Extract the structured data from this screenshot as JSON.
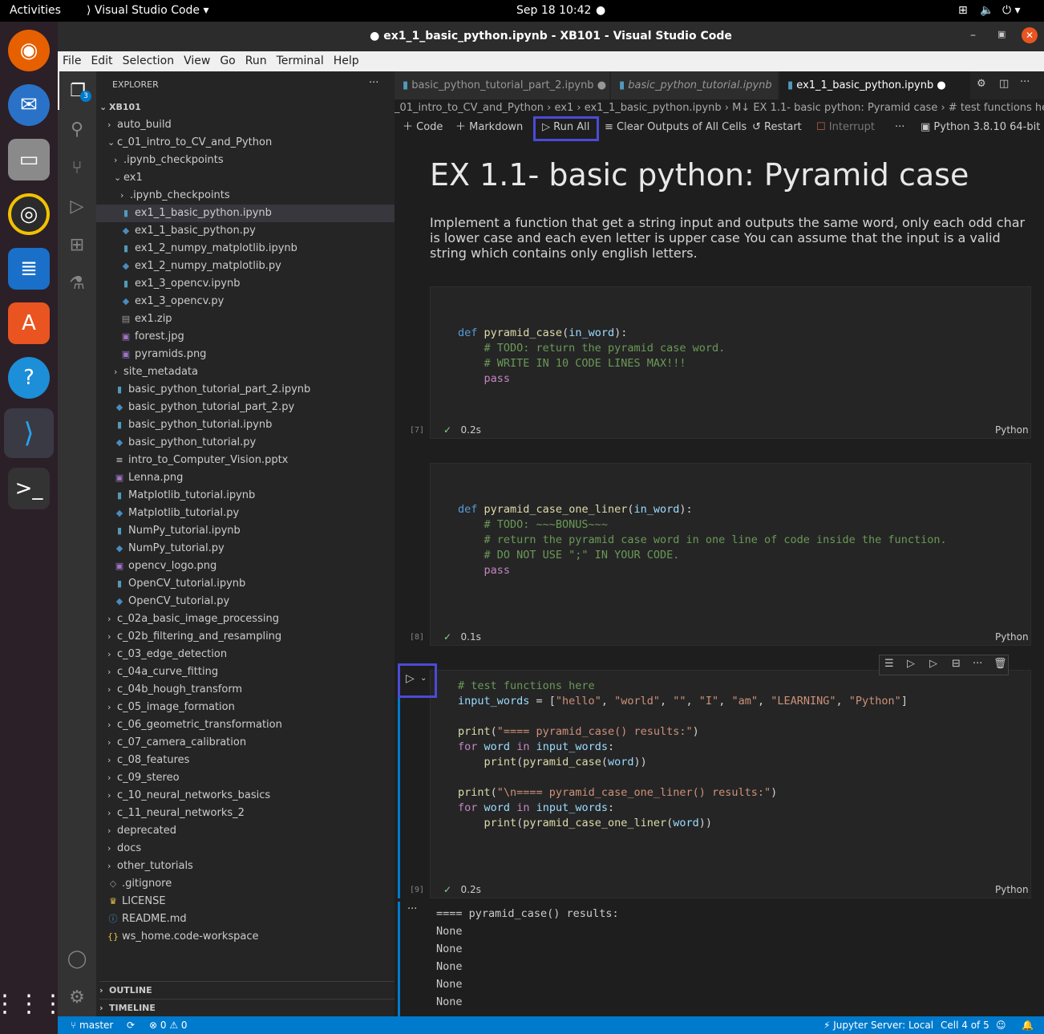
{
  "topbar": {
    "activities": "Activities",
    "app": "Visual Studio Code ▾",
    "clock": "Sep 18  10:42"
  },
  "window": {
    "title": "● ex1_1_basic_python.ipynb - XB101 - Visual Studio Code"
  },
  "menu": [
    "File",
    "Edit",
    "Selection",
    "View",
    "Go",
    "Run",
    "Terminal",
    "Help"
  ],
  "explorer": {
    "header": "EXPLORER",
    "root": "XB101",
    "outline": "OUTLINE",
    "timeline": "TIMELINE",
    "badge": "3",
    "tree": [
      {
        "label": "auto_build",
        "kind": "folder",
        "open": false,
        "indent": 0
      },
      {
        "label": "c_01_intro_to_CV_and_Python",
        "kind": "folder",
        "open": true,
        "indent": 0
      },
      {
        "label": ".ipynb_checkpoints",
        "kind": "folder",
        "open": false,
        "indent": 1
      },
      {
        "label": "ex1",
        "kind": "folder",
        "open": true,
        "indent": 1
      },
      {
        "label": ".ipynb_checkpoints",
        "kind": "folder",
        "open": false,
        "indent": 2
      },
      {
        "label": "ex1_1_basic_python.ipynb",
        "kind": "nb",
        "indent": 2,
        "selected": true
      },
      {
        "label": "ex1_1_basic_python.py",
        "kind": "py",
        "indent": 2
      },
      {
        "label": "ex1_2_numpy_matplotlib.ipynb",
        "kind": "nb",
        "indent": 2
      },
      {
        "label": "ex1_2_numpy_matplotlib.py",
        "kind": "py",
        "indent": 2
      },
      {
        "label": "ex1_3_opencv.ipynb",
        "kind": "nb",
        "indent": 2
      },
      {
        "label": "ex1_3_opencv.py",
        "kind": "py",
        "indent": 2
      },
      {
        "label": "ex1.zip",
        "kind": "zip",
        "indent": 2
      },
      {
        "label": "forest.jpg",
        "kind": "img",
        "indent": 2
      },
      {
        "label": "pyramids.png",
        "kind": "img",
        "indent": 2
      },
      {
        "label": "site_metadata",
        "kind": "folder",
        "open": false,
        "indent": 1
      },
      {
        "label": "basic_python_tutorial_part_2.ipynb",
        "kind": "nb",
        "indent": 1
      },
      {
        "label": "basic_python_tutorial_part_2.py",
        "kind": "py",
        "indent": 1
      },
      {
        "label": "basic_python_tutorial.ipynb",
        "kind": "nb",
        "indent": 1
      },
      {
        "label": "basic_python_tutorial.py",
        "kind": "py",
        "indent": 1
      },
      {
        "label": "intro_to_Computer_Vision.pptx",
        "kind": "pptx",
        "indent": 1
      },
      {
        "label": "Lenna.png",
        "kind": "img",
        "indent": 1
      },
      {
        "label": "Matplotlib_tutorial.ipynb",
        "kind": "nb",
        "indent": 1
      },
      {
        "label": "Matplotlib_tutorial.py",
        "kind": "py",
        "indent": 1
      },
      {
        "label": "NumPy_tutorial.ipynb",
        "kind": "nb",
        "indent": 1
      },
      {
        "label": "NumPy_tutorial.py",
        "kind": "py",
        "indent": 1
      },
      {
        "label": "opencv_logo.png",
        "kind": "img",
        "indent": 1
      },
      {
        "label": "OpenCV_tutorial.ipynb",
        "kind": "nb",
        "indent": 1
      },
      {
        "label": "OpenCV_tutorial.py",
        "kind": "py",
        "indent": 1
      },
      {
        "label": "c_02a_basic_image_processing",
        "kind": "folder",
        "open": false,
        "indent": 0
      },
      {
        "label": "c_02b_filtering_and_resampling",
        "kind": "folder",
        "open": false,
        "indent": 0
      },
      {
        "label": "c_03_edge_detection",
        "kind": "folder",
        "open": false,
        "indent": 0
      },
      {
        "label": "c_04a_curve_fitting",
        "kind": "folder",
        "open": false,
        "indent": 0
      },
      {
        "label": "c_04b_hough_transform",
        "kind": "folder",
        "open": false,
        "indent": 0
      },
      {
        "label": "c_05_image_formation",
        "kind": "folder",
        "open": false,
        "indent": 0
      },
      {
        "label": "c_06_geometric_transformation",
        "kind": "folder",
        "open": false,
        "indent": 0
      },
      {
        "label": "c_07_camera_calibration",
        "kind": "folder",
        "open": false,
        "indent": 0
      },
      {
        "label": "c_08_features",
        "kind": "folder",
        "open": false,
        "indent": 0
      },
      {
        "label": "c_09_stereo",
        "kind": "folder",
        "open": false,
        "indent": 0
      },
      {
        "label": "c_10_neural_networks_basics",
        "kind": "folder",
        "open": false,
        "indent": 0
      },
      {
        "label": "c_11_neural_networks_2",
        "kind": "folder",
        "open": false,
        "indent": 0
      },
      {
        "label": "deprecated",
        "kind": "folder",
        "open": false,
        "indent": 0
      },
      {
        "label": "docs",
        "kind": "folder",
        "open": false,
        "indent": 0
      },
      {
        "label": "other_tutorials",
        "kind": "folder",
        "open": false,
        "indent": 0
      },
      {
        "label": ".gitignore",
        "kind": "git",
        "indent": 0
      },
      {
        "label": "LICENSE",
        "kind": "license",
        "indent": 0
      },
      {
        "label": "README.md",
        "kind": "info",
        "indent": 0
      },
      {
        "label": "ws_home.code-workspace",
        "kind": "ws",
        "indent": 0
      }
    ]
  },
  "tabs": [
    {
      "label": "basic_python_tutorial_part_2.ipynb",
      "dirty": "●"
    },
    {
      "label": "basic_python_tutorial.ipynb",
      "dirty": ""
    },
    {
      "label": "ex1_1_basic_python.ipynb",
      "dirty": "●"
    }
  ],
  "breadcrumb": "_01_intro_to_CV_and_Python  ›  ex1  ›  ex1_1_basic_python.ipynb  ›  M↓ EX 1.1- basic python: Pyramid case  ›  # test functions here",
  "toolbar": {
    "code": "Code",
    "markdown": "Markdown",
    "run_all": "Run All",
    "clear": "Clear Outputs of All Cells",
    "restart": "Restart",
    "interrupt": "Interrupt",
    "kernel": "Python 3.8.10 64-bit"
  },
  "markdown": {
    "title": "EX 1.1- basic python: Pyramid case",
    "body": "Implement a function that get a string input and outputs the same word, only each odd char is lower case and each even letter is upper case You can assume that the input is a valid string which contains only english letters."
  },
  "cells": [
    {
      "count": "[7]",
      "time": "0.2s",
      "lang": "Python"
    },
    {
      "count": "[8]",
      "time": "0.1s",
      "lang": "Python"
    },
    {
      "count": "[9]",
      "time": "0.2s",
      "lang": "Python"
    }
  ],
  "output": {
    "header": "==== pyramid_case() results:",
    "lines": [
      "None",
      "None",
      "None",
      "None",
      "None"
    ]
  },
  "statusbar": {
    "branch": "master",
    "problems": "⊗ 0 ⚠ 0",
    "jupyter": "Jupyter Server: Local",
    "cell": "Cell 4 of 5"
  },
  "colors": {
    "accent": "#007acc",
    "highlight": "#4b4bd6"
  }
}
